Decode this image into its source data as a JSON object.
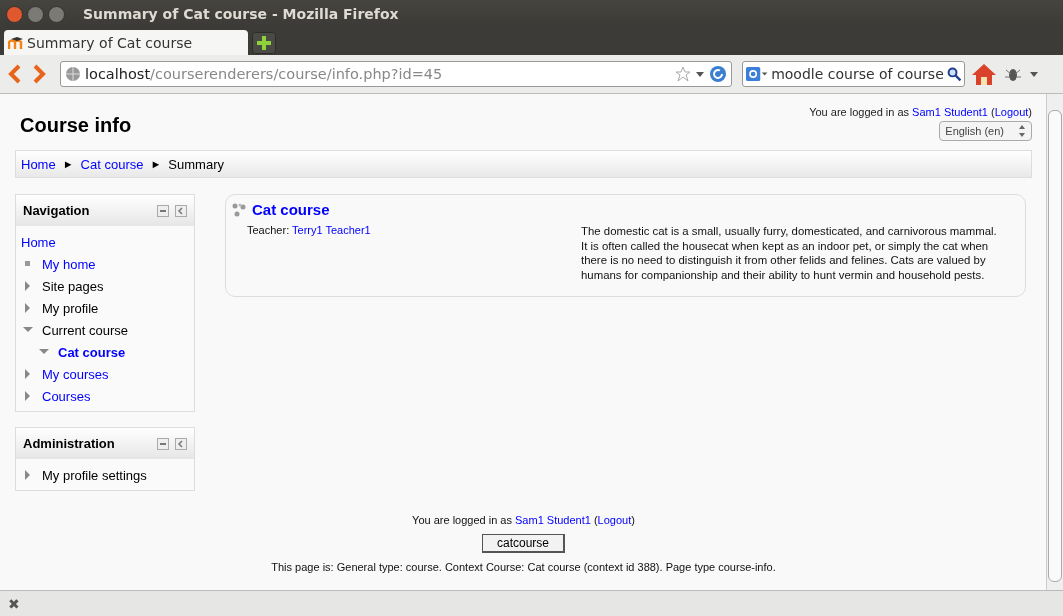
{
  "window": {
    "title": "Summary of Cat course - Mozilla Firefox"
  },
  "tabs": [
    {
      "label": "Summary of Cat course",
      "selected": true
    }
  ],
  "toolbar": {
    "url_host": "localhost",
    "url_path": "/courserenderers/course/info.php?id=45",
    "search": "moodle course of course"
  },
  "page": {
    "title": "Course info",
    "login": [
      {
        "kind": "text",
        "text": "You are logged in as "
      },
      {
        "kind": "link",
        "text": "Sam1 Student1"
      },
      {
        "kind": "text",
        "text": " ("
      },
      {
        "kind": "link",
        "text": "Logout"
      },
      {
        "kind": "text",
        "text": ")"
      }
    ],
    "language": "English (en)",
    "breadcrumb": [
      {
        "label": "Home",
        "link": true
      },
      {
        "label": "Cat course",
        "link": true
      },
      {
        "label": "Summary",
        "link": false
      }
    ],
    "breadcrumb_separator": "►"
  },
  "navigation": {
    "title": "Navigation",
    "items": [
      {
        "label": "Home",
        "kind": "root",
        "link": true,
        "selected": false,
        "children": [
          {
            "label": "My home",
            "kind": "leaf",
            "link": true,
            "selected": false
          },
          {
            "label": "Site pages",
            "kind": "branch",
            "link": false,
            "selected": false,
            "expanded": false
          },
          {
            "label": "My profile",
            "kind": "branch",
            "link": false,
            "selected": false,
            "expanded": false
          },
          {
            "label": "Current course",
            "kind": "branch",
            "link": false,
            "selected": false,
            "expanded": true,
            "children": [
              {
                "label": "Cat course",
                "kind": "branch",
                "link": true,
                "selected": true,
                "expanded": true
              }
            ]
          },
          {
            "label": "My courses",
            "kind": "branch",
            "link": true,
            "selected": false,
            "expanded": false
          },
          {
            "label": "Courses",
            "kind": "branch",
            "link": true,
            "selected": false,
            "expanded": false
          }
        ]
      }
    ]
  },
  "administration": {
    "title": "Administration",
    "items": [
      {
        "label": "My profile settings",
        "kind": "branch",
        "link": false,
        "selected": false,
        "expanded": false
      }
    ]
  },
  "course": {
    "title": "Cat course",
    "teacher_label": "Teacher: ",
    "teacher": "Terry1 Teacher1",
    "summary": "The domestic cat is a small, usually furry, domesticated, and carnivorous mammal. It is often called the housecat when kept as an indoor pet, or simply the cat when there is no need to distinguish it from other felids and felines. Cats are valued by humans for companionship and their ability to hunt vermin and household pests."
  },
  "footer": {
    "login": [
      {
        "kind": "text",
        "text": "You are logged in as "
      },
      {
        "kind": "link",
        "text": "Sam1 Student1"
      },
      {
        "kind": "text",
        "text": " ("
      },
      {
        "kind": "link",
        "text": "Logout"
      },
      {
        "kind": "text",
        "text": ")"
      }
    ],
    "button": "catcourse",
    "info": "This page is: General type: course. Context Course: Cat course (context id 388). Page type course-info."
  },
  "status_bar": {
    "close": "✖"
  }
}
